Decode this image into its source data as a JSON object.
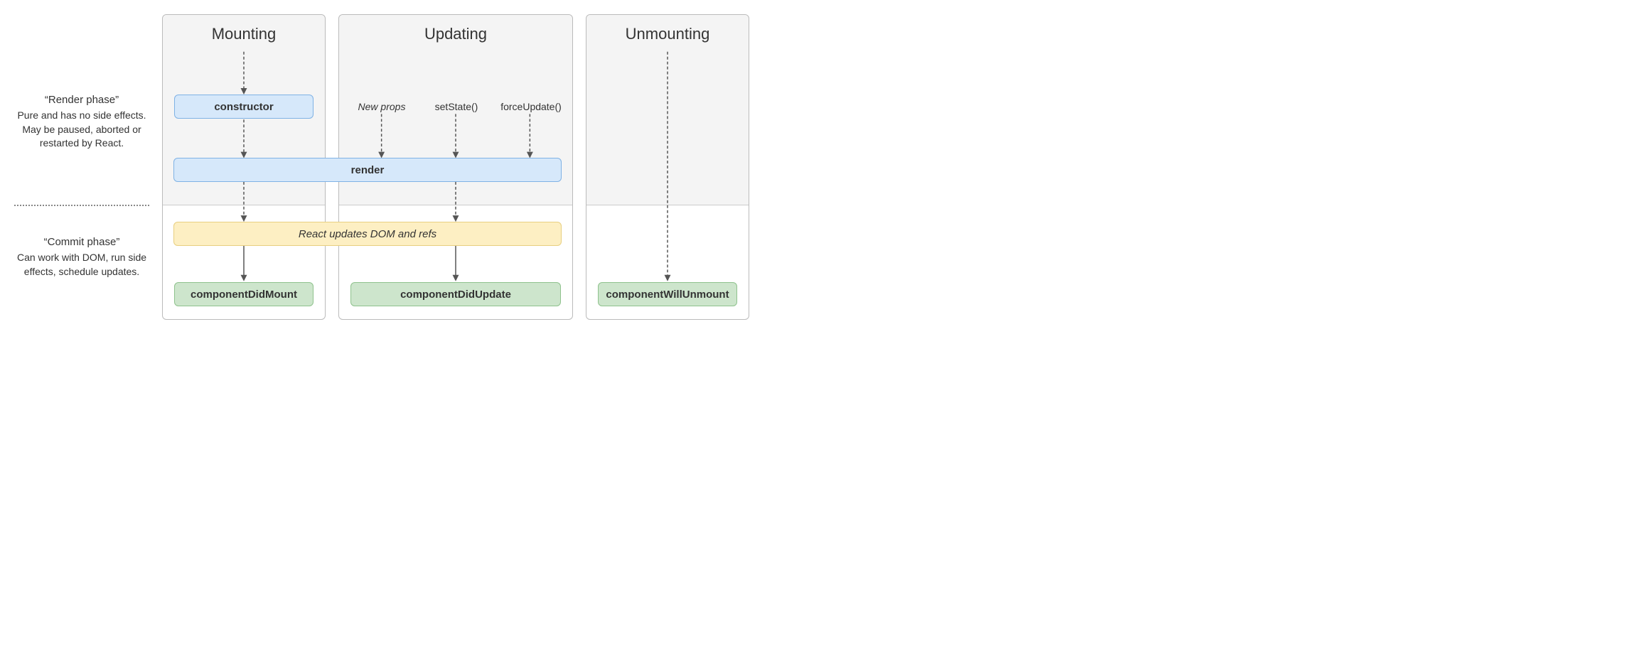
{
  "sidebar": {
    "render_phase": {
      "title": "“Render phase”",
      "desc": "Pure and has no side effects. May be paused, aborted or restarted by React."
    },
    "commit_phase": {
      "title": "“Commit phase”",
      "desc": "Can work with DOM, run side effects, schedule updates."
    }
  },
  "columns": {
    "mounting": {
      "title": "Mounting"
    },
    "updating": {
      "title": "Updating"
    },
    "unmounting": {
      "title": "Unmounting"
    }
  },
  "nodes": {
    "constructor": "constructor",
    "render": "render",
    "react_updates": "React updates DOM and refs",
    "did_mount": "componentDidMount",
    "did_update": "componentDidUpdate",
    "will_unmount": "componentWillUnmount"
  },
  "triggers": {
    "new_props": "New props",
    "set_state": "setState()",
    "force_update": "forceUpdate()"
  }
}
